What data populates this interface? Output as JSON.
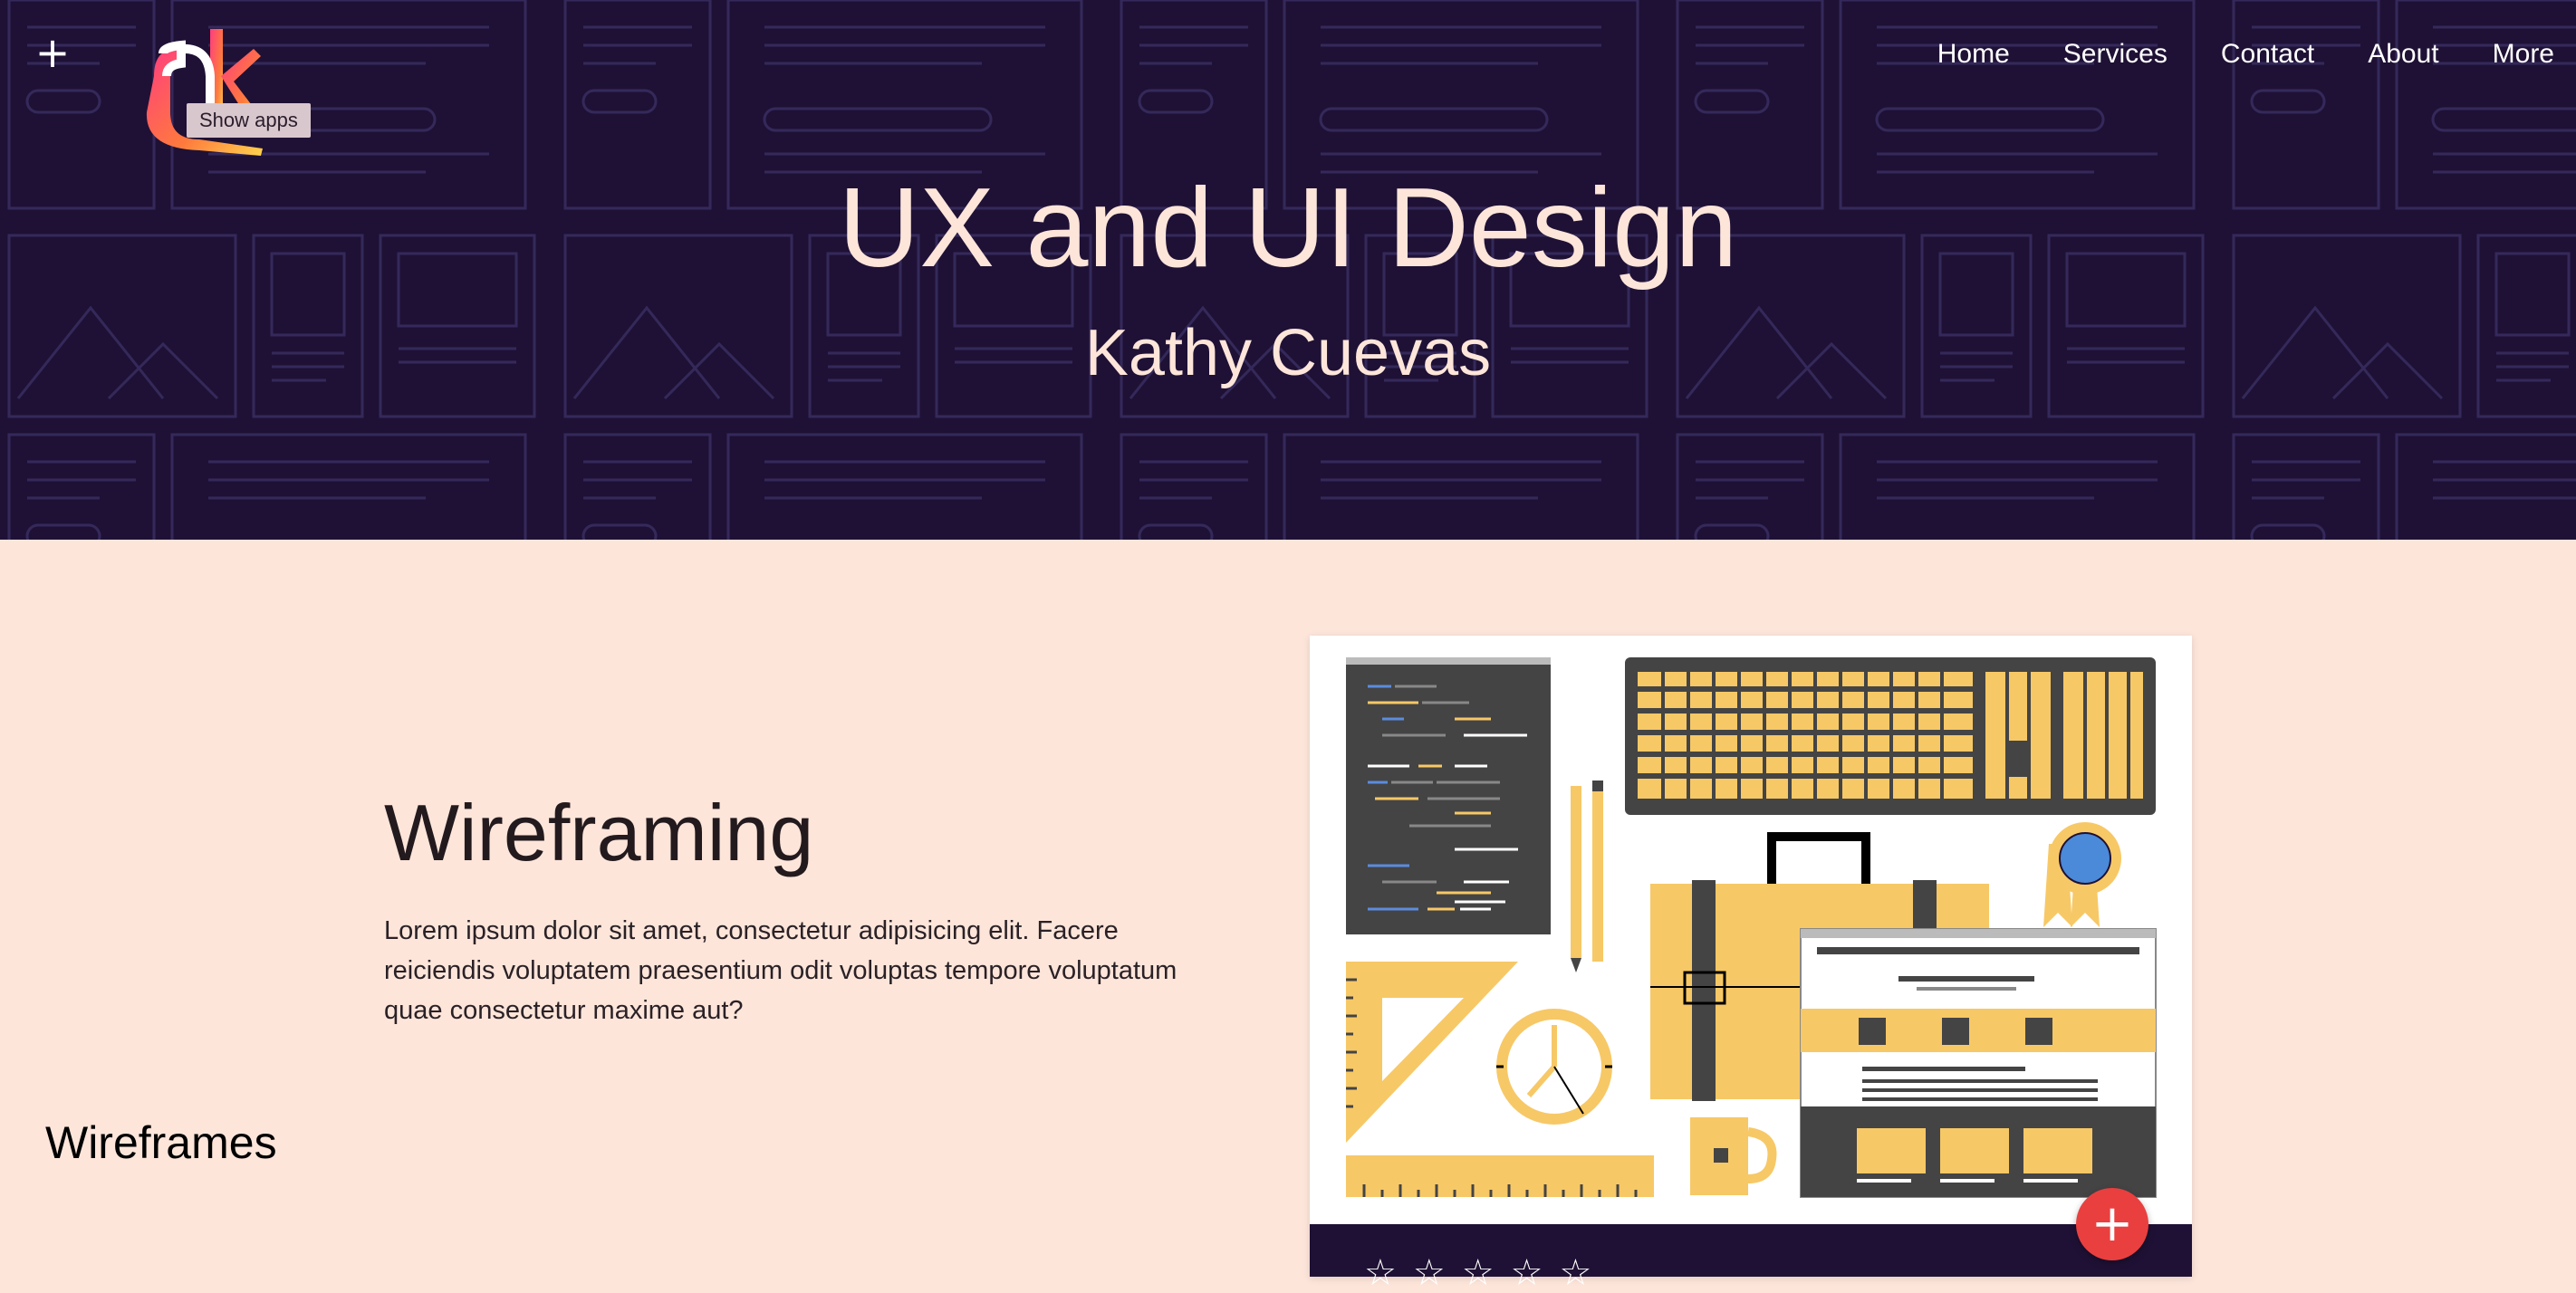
{
  "header": {
    "add_icon": "plus-icon",
    "logo_icon": "ok-logo-icon",
    "tooltip": "Show apps",
    "nav": [
      {
        "label": "Home"
      },
      {
        "label": "Services"
      },
      {
        "label": "Contact"
      },
      {
        "label": "About"
      },
      {
        "label": "More"
      }
    ]
  },
  "hero": {
    "title": "UX and UI Design",
    "subtitle": "Kathy Cuevas"
  },
  "feature": {
    "title": "Wireframing",
    "body": "Lorem ipsum dolor sit amet, consectetur adipisicing elit. Facere reiciendis voluptatem praesentium odit voluptas tempore voluptatum quae consectetur maxime aut?"
  },
  "card": {
    "label": "Wireframes",
    "fab_icon": "plus-icon",
    "stars": [
      "☆",
      "☆",
      "☆",
      "☆",
      "☆"
    ]
  },
  "colors": {
    "hero_bg": "#1f1135",
    "content_bg": "#fde5da",
    "accent_yellow": "#f7c866",
    "fab_red": "#ea3f3f"
  }
}
